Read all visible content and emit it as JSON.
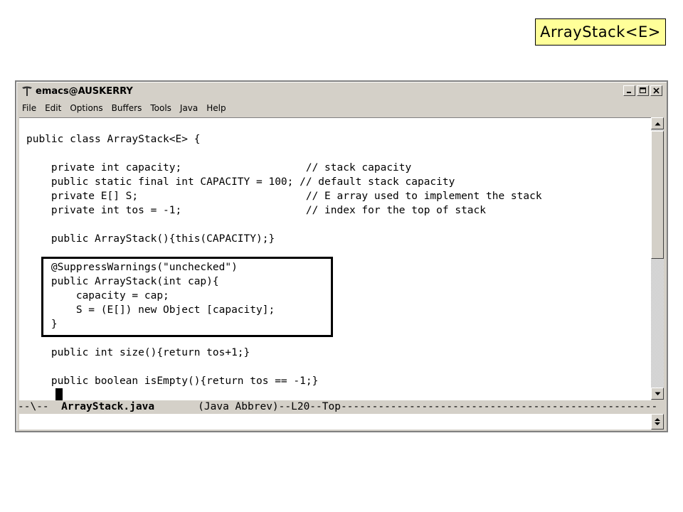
{
  "slide_label": "ArrayStack<E>",
  "window": {
    "title": "emacs@AUSKERRY",
    "buttons": [
      "minimize",
      "maximize",
      "close"
    ]
  },
  "menu": [
    "File",
    "Edit",
    "Options",
    "Buffers",
    "Tools",
    "Java",
    "Help"
  ],
  "code_lines": [
    "public class ArrayStack<E> {",
    "",
    "    private int capacity;                    // stack capacity",
    "    public static final int CAPACITY = 100; // default stack capacity",
    "    private E[] S;                           // E array used to implement the stack",
    "    private int tos = -1;                    // index for the top of stack",
    "",
    "    public ArrayStack(){this(CAPACITY);}",
    "",
    "    @SuppressWarnings(\"unchecked\")",
    "    public ArrayStack(int cap){",
    "        capacity = cap;",
    "        S = (E[]) new Object [capacity];",
    "    }",
    "",
    "    public int size(){return tos+1;}",
    "",
    "    public boolean isEmpty(){return tos == -1;}",
    ""
  ],
  "modeline": {
    "prefix": "--\\--  ",
    "buffer": "ArrayStack.java",
    "suffix": "       (Java Abbrev)--L20--Top---------------------------------------------------"
  },
  "icons": {
    "app": "emacs-gnu-icon",
    "scroll_up": "arrow-up-icon",
    "scroll_down": "arrow-down-icon"
  }
}
